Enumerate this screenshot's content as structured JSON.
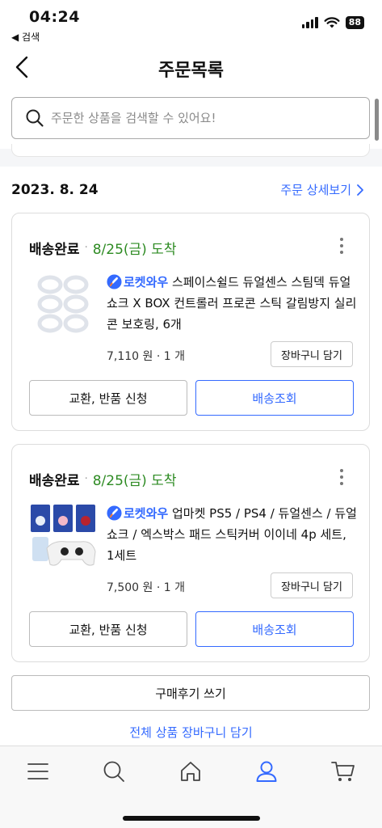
{
  "status_bar": {
    "time": "04:24",
    "back_app": "◀ 검색",
    "battery": "88"
  },
  "nav": {
    "title": "주문목록"
  },
  "search": {
    "placeholder": "주문한 상품을 검색할 수 있어요!"
  },
  "order": {
    "date": "2023. 8. 24",
    "detail_link": "주문 상세보기",
    "items": [
      {
        "status": "배송완료",
        "delivery": "8/25(금) 도착",
        "badge": "로켓와우",
        "name": "스페이스쉴드 듀얼센스 스팀덱 듀얼쇼크 X BOX 컨트롤러 프로콘 스틱 갈림방지 실리콘 보호링, 6개",
        "price": "7,110 원 · 1 개",
        "cart_label": "장바구니 담기",
        "exchange_label": "교환, 반품 신청",
        "track_label": "배송조회"
      },
      {
        "status": "배송완료",
        "delivery": "8/25(금) 도착",
        "badge": "로켓와우",
        "name": "업마켓 PS5 / PS4 / 듀얼센스 / 듀얼쇼크 / 엑스박스 패드 스틱커버 이이네 4p 세트, 1세트",
        "price": "7,500 원 · 1 개",
        "cart_label": "장바구니 담기",
        "exchange_label": "교환, 반품 신청",
        "track_label": "배송조회"
      }
    ],
    "review_label": "구매후기 쓰기",
    "add_all_label": "전체 상품 장바구니 담기"
  },
  "tabbar": {
    "tabs": [
      {
        "icon": "menu-icon",
        "active": false
      },
      {
        "icon": "search-icon",
        "active": false
      },
      {
        "icon": "home-icon",
        "active": false
      },
      {
        "icon": "user-icon",
        "active": true
      },
      {
        "icon": "cart-icon",
        "active": false
      }
    ]
  },
  "colors": {
    "accent": "#346aff",
    "delivered": "#2e8b23",
    "text": "#111111"
  }
}
